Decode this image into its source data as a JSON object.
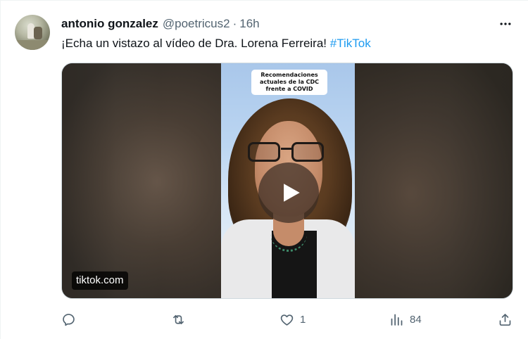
{
  "tweet": {
    "author_name": "antonio gonzalez",
    "handle": "@poetricus2",
    "separator": "·",
    "time": "16h",
    "text": "¡Echa un vistazo al vídeo de Dra. Lorena Ferreira! ",
    "hashtag": "#TikTok"
  },
  "media": {
    "video_caption": "Recomendaciones actuales de la CDC frente a COVID",
    "source_label": "tiktok.com"
  },
  "actions": {
    "replies": "",
    "retweets": "",
    "likes": "1",
    "views": "84"
  },
  "icons": {
    "more": "more-icon",
    "reply": "reply-icon",
    "retweet": "retweet-icon",
    "like": "heart-icon",
    "views": "views-icon",
    "share": "share-icon",
    "play": "play-icon"
  },
  "colors": {
    "text": "#0f1419",
    "secondary": "#536471",
    "link": "#1d9bf0"
  }
}
